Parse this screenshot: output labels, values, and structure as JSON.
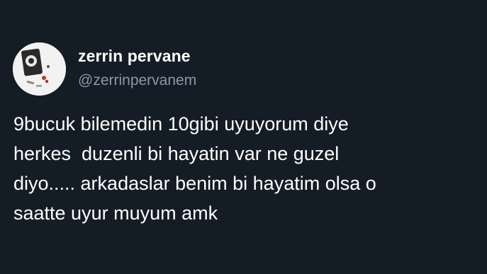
{
  "tweet": {
    "author": {
      "display_name": "zerrin pervane",
      "handle": "@zerrinpervanem",
      "avatar_icon": "profile-photo-icon"
    },
    "text_lines": [
      "9bucuk bilemedin 10gibi uyuyorum diye",
      "herkes  duzenli bi hayatin var ne guzel",
      "diyo..... arkadaslar benim bi hayatim olsa o",
      "saatte uyur muyum amk"
    ]
  },
  "colors": {
    "background": "#141d26",
    "primary_text": "#ffffff",
    "secondary_text": "#8b98a5"
  }
}
